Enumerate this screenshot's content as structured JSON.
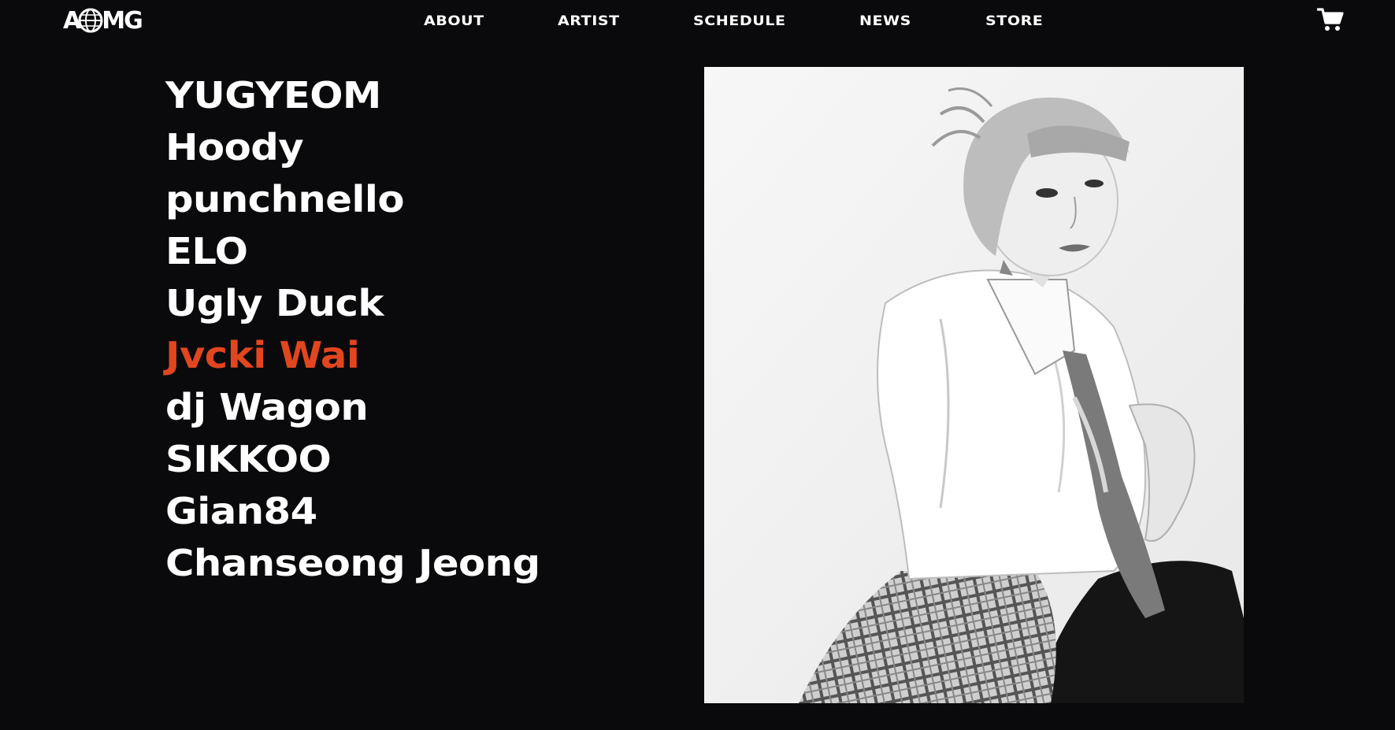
{
  "logo": {
    "text_left": "A",
    "text_right": "MG",
    "icon": "globe-icon"
  },
  "nav": {
    "items": [
      {
        "label": "ABOUT"
      },
      {
        "label": "ARTIST"
      },
      {
        "label": "SCHEDULE"
      },
      {
        "label": "NEWS"
      },
      {
        "label": "STORE"
      }
    ]
  },
  "cart": {
    "icon": "shopping-cart-icon"
  },
  "artists": {
    "active_index": 5,
    "items": [
      {
        "name": "YUGYEOM"
      },
      {
        "name": "Hoody"
      },
      {
        "name": "punchnello"
      },
      {
        "name": "ELO"
      },
      {
        "name": "Ugly Duck"
      },
      {
        "name": "Jvcki Wai"
      },
      {
        "name": "dj Wagon"
      },
      {
        "name": "SIKKOO"
      },
      {
        "name": "Gian84"
      },
      {
        "name": "Chanseong Jeong"
      }
    ]
  },
  "colors": {
    "background": "#0a0a0c",
    "text": "#ffffff",
    "accent": "#e2461f"
  }
}
